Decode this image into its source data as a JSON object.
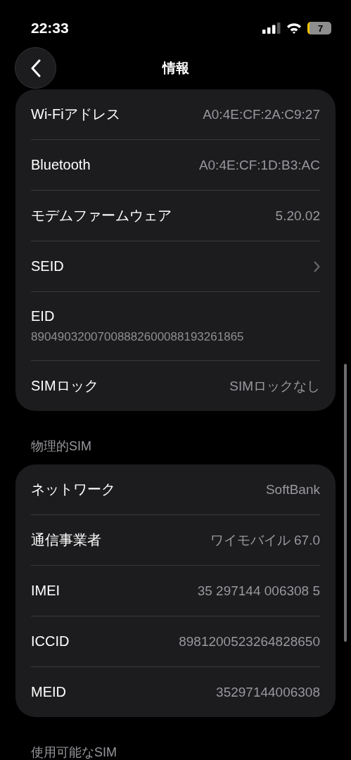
{
  "status_bar": {
    "time": "22:33",
    "battery": "7"
  },
  "nav": {
    "title": "情報"
  },
  "sections": [
    {
      "rows": [
        {
          "kind": "value",
          "label": "Wi-Fiアドレス",
          "value": "A0:4E:CF:2A:C9:27"
        },
        {
          "kind": "value",
          "label": "Bluetooth",
          "value": "A0:4E:CF:1D:B3:AC"
        },
        {
          "kind": "value",
          "label": "モデムファームウェア",
          "value": "5.20.02"
        },
        {
          "kind": "chevron",
          "label": "SEID"
        },
        {
          "kind": "stacked",
          "label": "EID",
          "value": "89049032007008882600088193261865"
        },
        {
          "kind": "value",
          "label": "SIMロック",
          "value": "SIMロックなし"
        }
      ]
    },
    {
      "header": "物理的SIM",
      "rows": [
        {
          "kind": "value",
          "label": "ネットワーク",
          "value": "SoftBank"
        },
        {
          "kind": "value",
          "label": "通信事業者",
          "value": "ワイモバイル 67.0"
        },
        {
          "kind": "value",
          "label": "IMEI",
          "value": "35 297144 006308 5"
        },
        {
          "kind": "value",
          "label": "ICCID",
          "value": "8981200523264828650"
        },
        {
          "kind": "value",
          "label": "MEID",
          "value": "35297144006308"
        }
      ]
    },
    {
      "header": "使用可能なSIM"
    }
  ]
}
